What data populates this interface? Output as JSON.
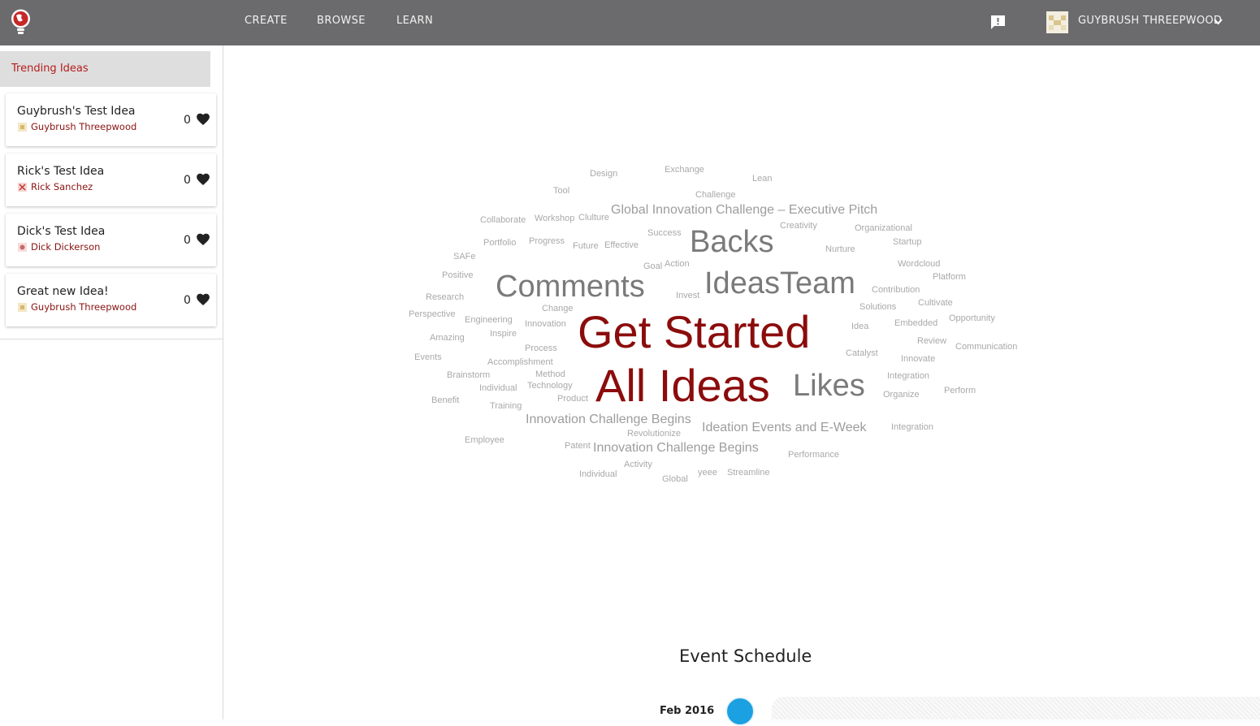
{
  "nav": {
    "links": [
      "CREATE",
      "BROWSE",
      "LEARN"
    ],
    "user_name": "GUYBRUSH THREEPWOOD"
  },
  "sidebar": {
    "header": "Trending Ideas",
    "ideas": [
      {
        "title": "Guybrush's Test Idea",
        "author": "Guybrush Threepwood",
        "likes": "0"
      },
      {
        "title": "Rick's Test Idea",
        "author": "Rick Sanchez",
        "likes": "0"
      },
      {
        "title": "Dick's Test Idea",
        "author": "Dick Dickerson",
        "likes": "0"
      },
      {
        "title": "Great new Idea!",
        "author": "Guybrush Threepwood",
        "likes": "0"
      }
    ]
  },
  "word_cloud": {
    "words": [
      "Design",
      "Exchange",
      "Lean",
      "Tool",
      "Challenge",
      "Global Innovation Challenge – Executive Pitch",
      "Collaborate",
      "Workshop",
      "Clulture",
      "Creativity",
      "Organizational",
      "Portfolio",
      "Progress",
      "Future",
      "Effective",
      "Success",
      "Backs",
      "Nurture",
      "Startup",
      "SAFe",
      "Goal",
      "Action",
      "Wordcloud",
      "Positive",
      "Comments",
      "Ideas",
      "Team",
      "Platform",
      "Research",
      "Invest",
      "Contribution",
      "Cultivate",
      "Perspective",
      "Change",
      "Solutions",
      "Opportunity",
      "Engineering",
      "Innovation",
      "Get Started",
      "Idea",
      "Embedded",
      "Amazing",
      "Inspire",
      "Review",
      "Communication",
      "Process",
      "Catalyst",
      "Events",
      "Accomplishment",
      "Innovate",
      "Brainstorm",
      "Method",
      "All Ideas",
      "Likes",
      "Integration",
      "Individual",
      "Technology",
      "Organize",
      "Perform",
      "Benefit",
      "Product",
      "Training",
      "Innovation Challenge Begins",
      "Ideation Events and E-Week",
      "Integration",
      "Revolutionize",
      "Employee",
      "Patent",
      "Innovation Challenge Begins",
      "Performance",
      "Activity",
      "Individual",
      "yeee",
      "Streamline",
      "Global"
    ]
  },
  "events": {
    "title": "Event Schedule",
    "items": [
      {
        "date": "Feb 2016"
      }
    ]
  },
  "colors": {
    "topbar": "#6b6b6d",
    "accent_red": "#b71c1c",
    "cloud_highlight": "#8b0c0c",
    "event_dot": "#1ba1e2"
  },
  "icons": [
    "lightbulb-globe-logo-icon",
    "feedback-icon",
    "user-avatar-icon",
    "chevron-down-icon",
    "heart-icon"
  ]
}
